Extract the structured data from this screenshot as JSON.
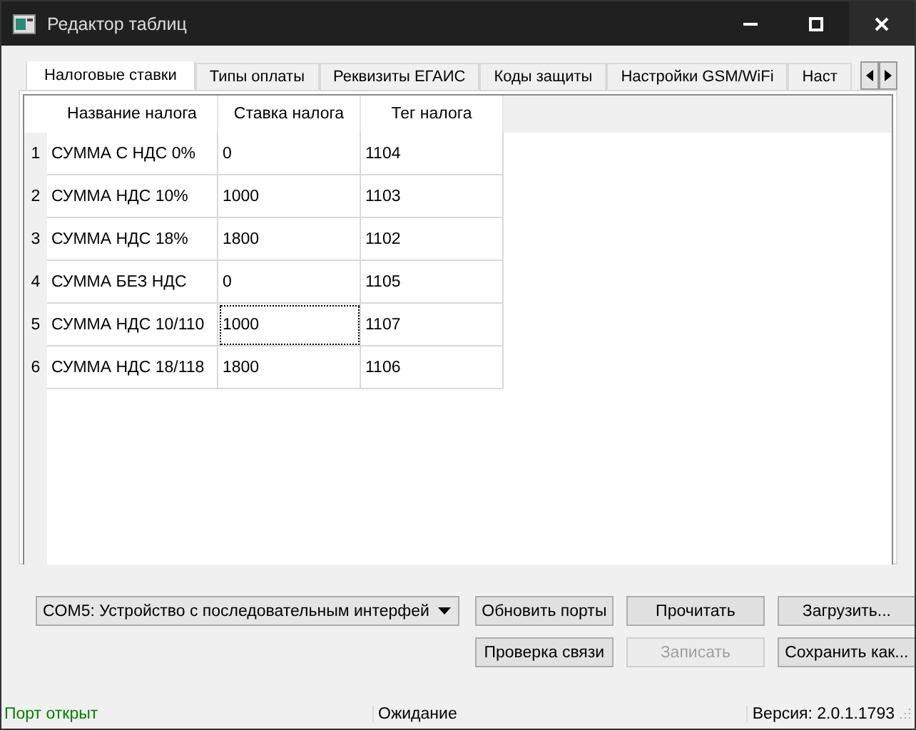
{
  "window": {
    "title": "Редактор таблиц"
  },
  "tabs": [
    {
      "label": "Налоговые ставки",
      "selected": true
    },
    {
      "label": "Типы оплаты",
      "selected": false
    },
    {
      "label": "Реквизиты ЕГАИС",
      "selected": false
    },
    {
      "label": "Коды защиты",
      "selected": false
    },
    {
      "label": "Настройки GSM/WiFi",
      "selected": false
    },
    {
      "label": "Наст",
      "selected": false
    }
  ],
  "table": {
    "columns": [
      "Название налога",
      "Ставка налога",
      "Тег налога"
    ],
    "rows": [
      {
        "number": "1",
        "cells": [
          {
            "text": "СУММА С НДС 0%",
            "focused": false
          },
          {
            "text": "0",
            "focused": false
          },
          {
            "text": "1104",
            "focused": false
          }
        ]
      },
      {
        "number": "2",
        "cells": [
          {
            "text": "СУММА НДС 10%",
            "focused": false
          },
          {
            "text": "1000",
            "focused": false
          },
          {
            "text": "1103",
            "focused": false
          }
        ]
      },
      {
        "number": "3",
        "cells": [
          {
            "text": "СУММА НДС 18%",
            "focused": false
          },
          {
            "text": "1800",
            "focused": false
          },
          {
            "text": "1102",
            "focused": false
          }
        ]
      },
      {
        "number": "4",
        "cells": [
          {
            "text": "СУММА БЕЗ НДС",
            "focused": false
          },
          {
            "text": "0",
            "focused": false
          },
          {
            "text": "1105",
            "focused": false
          }
        ]
      },
      {
        "number": "5",
        "cells": [
          {
            "text": "СУММА НДС 10/110",
            "focused": false
          },
          {
            "text": "1000",
            "focused": true
          },
          {
            "text": "1107",
            "focused": false
          }
        ]
      },
      {
        "number": "6",
        "cells": [
          {
            "text": "СУММА НДС 18/118",
            "focused": false
          },
          {
            "text": "1800",
            "focused": false
          },
          {
            "text": "1106",
            "focused": false
          }
        ]
      }
    ]
  },
  "port_select": {
    "value": "COM5: Устройство с последовательным интерфей"
  },
  "buttons": [
    {
      "label": "Обновить порты",
      "disabled": false
    },
    {
      "label": "Прочитать",
      "disabled": false
    },
    {
      "label": "Загрузить...",
      "disabled": false
    },
    {
      "label": "Проверка связи",
      "disabled": false
    },
    {
      "label": "Записать",
      "disabled": true
    },
    {
      "label": "Сохранить как...",
      "disabled": false
    }
  ],
  "status_bar": [
    {
      "text": "Порт открыт",
      "color": "#008000"
    },
    {
      "text": "Ожидание",
      "color": "#000000"
    },
    {
      "text": "Версия: 2.0.1.1793",
      "color": "#000000"
    }
  ]
}
